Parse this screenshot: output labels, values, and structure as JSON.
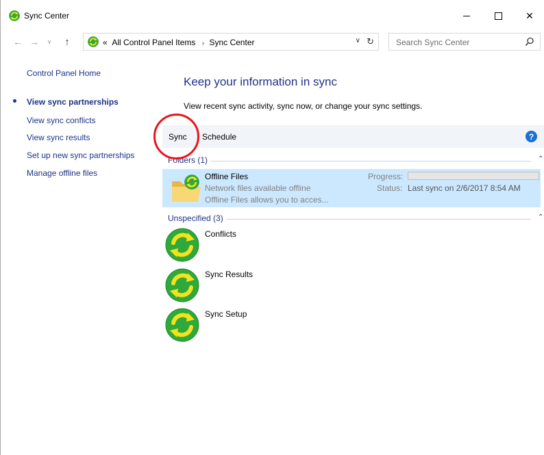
{
  "window": {
    "title": "Sync Center",
    "icon": "sync-center-icon"
  },
  "address": {
    "overflow": "«",
    "crumbs": [
      "All Control Panel Items",
      "Sync Center"
    ],
    "separator": "›",
    "search_placeholder": "Search Sync Center"
  },
  "leftnav": {
    "home": "Control Panel Home",
    "items": [
      "View sync partnerships",
      "View sync conflicts",
      "View sync results",
      "Set up new sync partnerships",
      "Manage offline files"
    ]
  },
  "main": {
    "heading": "Keep your information in sync",
    "subtext": "View recent sync activity, sync now, or change your sync settings."
  },
  "toolbar": {
    "sync_label": "Sync",
    "schedule_label": "Schedule",
    "help_label": "?"
  },
  "groups": {
    "folders": {
      "label": "Folders (1)",
      "items": [
        {
          "title": "Offline Files",
          "line2": "Network files available offline",
          "line3": "Offline Files allows you to acces...",
          "progress_label": "Progress:",
          "progress_fraction": 0,
          "status_label": "Status:",
          "status_value": "Last sync on 2/6/2017 8:54 AM"
        }
      ]
    },
    "unspecified": {
      "label": "Unspecified (3)",
      "items": [
        "Conflicts",
        "Sync Results",
        "Sync Setup"
      ]
    }
  },
  "colors": {
    "link": "#1e3287",
    "selected_row": "#cce8ff",
    "toolbar_bg": "#f1f4f8",
    "annotation": "#e8141a",
    "sync_green": "#2ea93a",
    "sync_arrows": "#f4e21c"
  }
}
